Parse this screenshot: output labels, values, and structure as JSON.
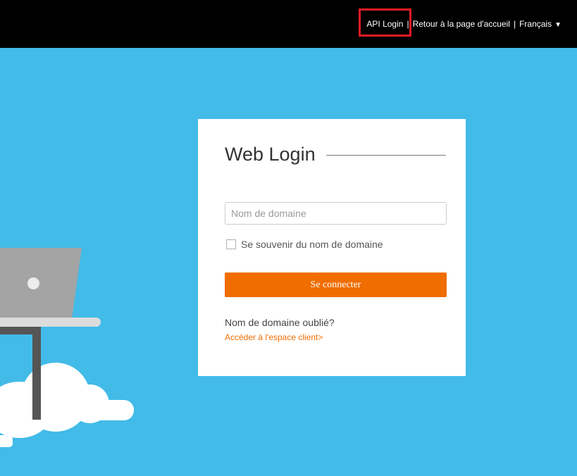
{
  "header": {
    "api_login": "API Login",
    "separator_1": "|",
    "home_link": "Retour à la page d'accueil",
    "separator_2": "|",
    "language": "Français",
    "language_caret": "▼",
    "highlight_color": "#e21b24"
  },
  "login": {
    "title": "Web Login",
    "domain_placeholder": "Nom de domaine",
    "domain_value": "",
    "remember_label": "Se souvenir du nom de domaine",
    "remember_checked": false,
    "submit_label": "Se connecter",
    "forgot_text": "Nom de domaine oublié?",
    "client_link": "Accéder à l'espace client>"
  },
  "colors": {
    "background": "#42bbe8",
    "topbar": "#000000",
    "accent": "#f06d00",
    "card": "#ffffff"
  }
}
